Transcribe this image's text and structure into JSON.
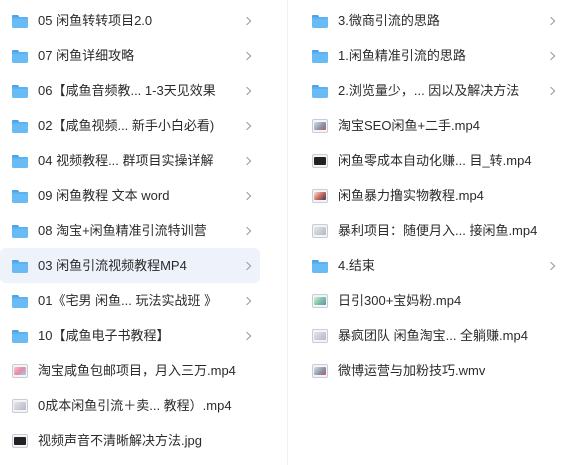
{
  "left_items": [
    {
      "label": "05 闲鱼转转项目2.0",
      "type": "folder",
      "has_chevron": true
    },
    {
      "label": "07 闲鱼详细攻略",
      "type": "folder",
      "has_chevron": true
    },
    {
      "label": "06【咸鱼音频教...  1-3天见效果",
      "type": "folder",
      "has_chevron": true
    },
    {
      "label": "02【咸鱼视频...  新手小白必看)",
      "type": "folder",
      "has_chevron": true
    },
    {
      "label": "04 视频教程...   群项目实操详解",
      "type": "folder",
      "has_chevron": true
    },
    {
      "label": "09 闲鱼教程 文本 word",
      "type": "folder",
      "has_chevron": true
    },
    {
      "label": "08 淘宝+闲鱼精准引流特训营",
      "type": "folder",
      "has_chevron": true
    },
    {
      "label": "03 闲鱼引流视频教程MP4",
      "type": "folder",
      "has_chevron": true,
      "selected": true
    },
    {
      "label": "01《宅男 闲鱼...   玩法实战班 》",
      "type": "folder",
      "has_chevron": true
    },
    {
      "label": "10【咸鱼电子书教程】",
      "type": "folder",
      "has_chevron": true
    },
    {
      "label": "淘宝咸鱼包邮项目，月入三万.mp4",
      "type": "video",
      "variant": "pink",
      "has_chevron": false
    },
    {
      "label": "0成本闲鱼引流＋卖...  教程）.mp4",
      "type": "video",
      "variant": "gray",
      "has_chevron": false
    },
    {
      "label": "视频声音不清晰解决方法.jpg",
      "type": "video",
      "variant": "dark",
      "has_chevron": false
    }
  ],
  "right_items": [
    {
      "label": "3.微商引流的思路",
      "type": "folder",
      "has_chevron": true
    },
    {
      "label": "1.闲鱼精准引流的思路",
      "type": "folder",
      "has_chevron": true
    },
    {
      "label": "2.浏览量少，...  因以及解决方法",
      "type": "folder",
      "has_chevron": true
    },
    {
      "label": "淘宝SEO闲鱼+二手.mp4",
      "type": "video",
      "variant": "light",
      "has_chevron": false
    },
    {
      "label": "闲鱼零成本自动化赚...  目_转.mp4",
      "type": "video",
      "variant": "dark",
      "has_chevron": false
    },
    {
      "label": "闲鱼暴力撸实物教程.mp4",
      "type": "video",
      "variant": "red",
      "has_chevron": false
    },
    {
      "label": "暴利项目：随便月入...  接闲鱼.mp4",
      "type": "video",
      "variant": "gray",
      "has_chevron": false
    },
    {
      "label": "4.结束",
      "type": "folder",
      "has_chevron": true
    },
    {
      "label": "日引300+宝妈粉.mp4",
      "type": "video",
      "variant": "green",
      "has_chevron": false
    },
    {
      "label": "暴疯团队 闲鱼淘宝...   全躺赚.mp4",
      "type": "video",
      "variant": "gray",
      "has_chevron": false
    },
    {
      "label": "微博运营与加粉技巧.wmv",
      "type": "video",
      "variant": "light",
      "has_chevron": false
    }
  ],
  "icon_names": {
    "folder": "folder-icon",
    "video": "video-thumbnail-icon",
    "chevron": "chevron-right-icon"
  }
}
